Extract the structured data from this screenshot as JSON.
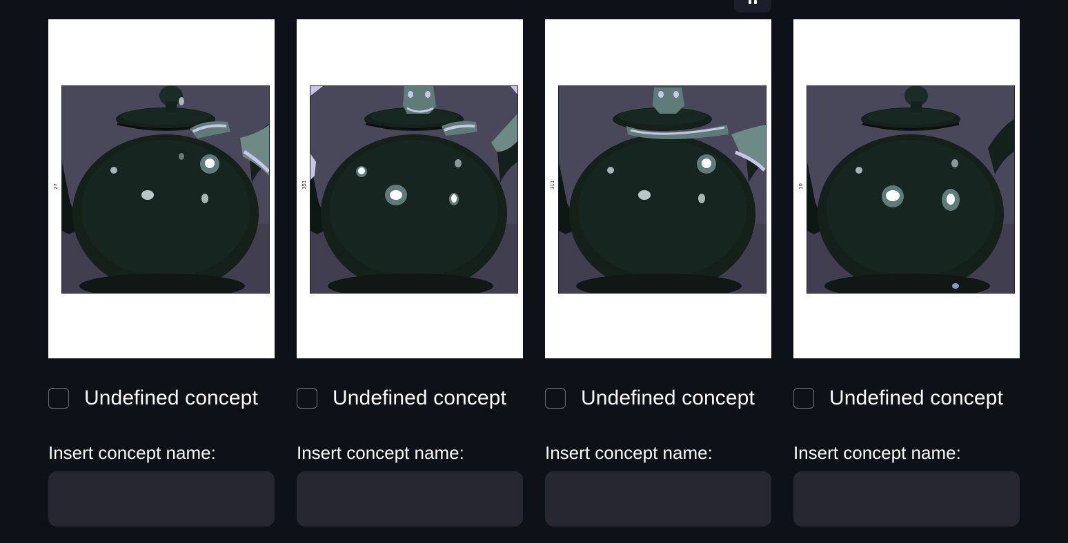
{
  "columns": [
    {
      "tick_label": "27",
      "checkbox_label": "Undefined concept",
      "input_label": "Insert concept name:",
      "input_value": ""
    },
    {
      "tick_label": "351",
      "checkbox_label": "Undefined concept",
      "input_label": "Insert concept name:",
      "input_value": ""
    },
    {
      "tick_label": "311",
      "checkbox_label": "Undefined concept",
      "input_label": "Insert concept name:",
      "input_value": ""
    },
    {
      "tick_label": "10",
      "checkbox_label": "Undefined concept",
      "input_label": "Insert concept name:",
      "input_value": ""
    }
  ],
  "icons": {
    "drag_handle": "grip-icon"
  },
  "colors": {
    "background": "#0e1117",
    "input_background": "#262730",
    "text": "#fafafa",
    "image_background": "#49475a",
    "teapot": "#141d1a",
    "highlight": "#5f7c78"
  }
}
